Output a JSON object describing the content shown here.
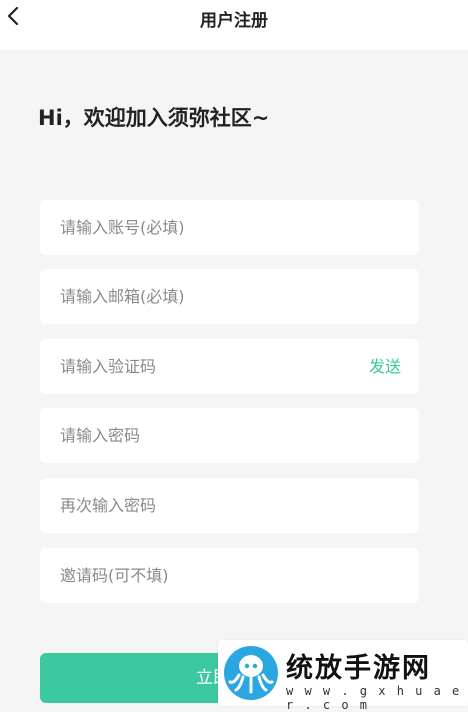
{
  "header": {
    "title": "用户注册",
    "back_icon": "chevron-left-icon"
  },
  "welcome_text": "Hi，欢迎加入须弥社区~",
  "form": {
    "fields": [
      {
        "name": "account",
        "placeholder": "请输入账号(必填)",
        "value": ""
      },
      {
        "name": "email",
        "placeholder": "请输入邮箱(必填)",
        "value": ""
      },
      {
        "name": "verification_code",
        "placeholder": "请输入验证码",
        "value": "",
        "action_label": "发送"
      },
      {
        "name": "password",
        "placeholder": "请输入密码",
        "value": ""
      },
      {
        "name": "confirm_password",
        "placeholder": "再次输入密码",
        "value": ""
      },
      {
        "name": "invite_code",
        "placeholder": "邀请码(可不填)",
        "value": ""
      }
    ],
    "submit_label": "立即注册"
  },
  "watermark": {
    "name": "统放手游网",
    "url": "w w w . g x h u a e r . c o m",
    "logo_icon": "octopus-logo-icon"
  },
  "colors": {
    "accent": "#3cc8a0",
    "background": "#f5f5f5",
    "card": "#ffffff"
  }
}
